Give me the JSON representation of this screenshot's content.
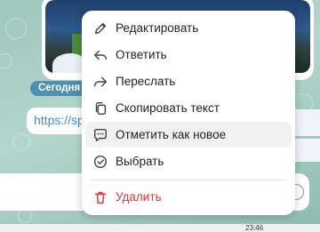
{
  "chat": {
    "date_chip": "Сегодня",
    "message_link_preview": "https://sp",
    "clock": "23:46"
  },
  "context_menu": {
    "items": [
      {
        "label": "Редактировать",
        "icon": "pencil-icon"
      },
      {
        "label": "Ответить",
        "icon": "reply-icon"
      },
      {
        "label": "Переслать",
        "icon": "forward-icon"
      },
      {
        "label": "Скопировать текст",
        "icon": "copy-icon"
      },
      {
        "label": "Отметить как новое",
        "icon": "mark-unread-icon"
      },
      {
        "label": "Выбрать",
        "icon": "select-check-icon"
      }
    ],
    "delete": {
      "label": "Удалить",
      "icon": "trash-icon"
    }
  },
  "colors": {
    "accent_blue": "#3a8fd1",
    "danger_red": "#e0313b",
    "date_chip_bg": "#4f8fb0"
  }
}
